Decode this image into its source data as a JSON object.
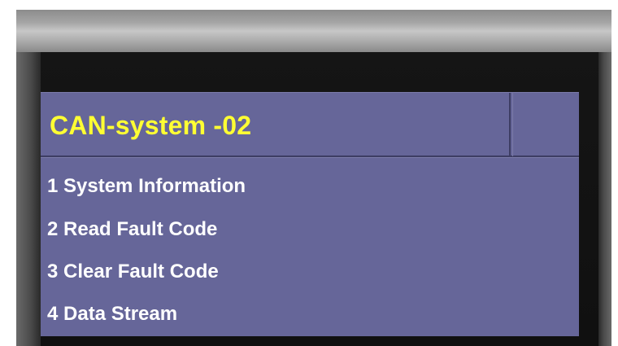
{
  "screen": {
    "title": "CAN-system -02"
  },
  "menu": {
    "items": [
      {
        "label": "1 System Information"
      },
      {
        "label": "2 Read Fault Code"
      },
      {
        "label": "3 Clear Fault Code"
      },
      {
        "label": "4 Data Stream"
      }
    ]
  },
  "colors": {
    "screen_background": "#666699",
    "title_text": "#ffff33",
    "menu_text": "#ffffff",
    "bezel": "#1a1a1a"
  }
}
